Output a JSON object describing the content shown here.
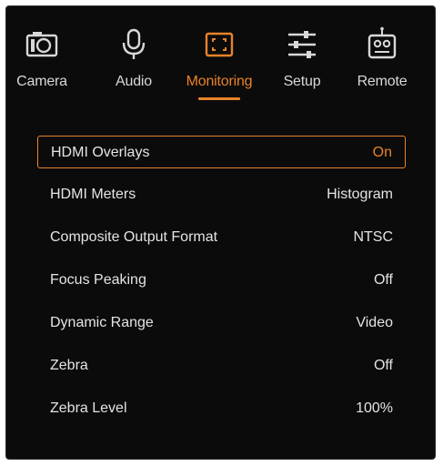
{
  "tabs": [
    {
      "id": "camera",
      "label": "Camera",
      "icon": "camera-icon",
      "active": false
    },
    {
      "id": "audio",
      "label": "Audio",
      "icon": "microphone-icon",
      "active": false
    },
    {
      "id": "monitoring",
      "label": "Monitoring",
      "icon": "monitor-frame-icon",
      "active": true
    },
    {
      "id": "setup",
      "label": "Setup",
      "icon": "sliders-icon",
      "active": false
    },
    {
      "id": "remote",
      "label": "Remote",
      "icon": "remote-control-icon",
      "active": false
    }
  ],
  "settings": [
    {
      "name": "HDMI Overlays",
      "value": "On",
      "selected": true
    },
    {
      "name": "HDMI Meters",
      "value": "Histogram",
      "selected": false
    },
    {
      "name": "Composite Output Format",
      "value": "NTSC",
      "selected": false
    },
    {
      "name": "Focus Peaking",
      "value": "Off",
      "selected": false
    },
    {
      "name": "Dynamic Range",
      "value": "Video",
      "selected": false
    },
    {
      "name": "Zebra",
      "value": "Off",
      "selected": false
    },
    {
      "name": "Zebra Level",
      "value": "100%",
      "selected": false
    }
  ],
  "colors": {
    "accent": "#e8832a",
    "background": "#0b0b0b",
    "text": "#e4e4e4"
  }
}
